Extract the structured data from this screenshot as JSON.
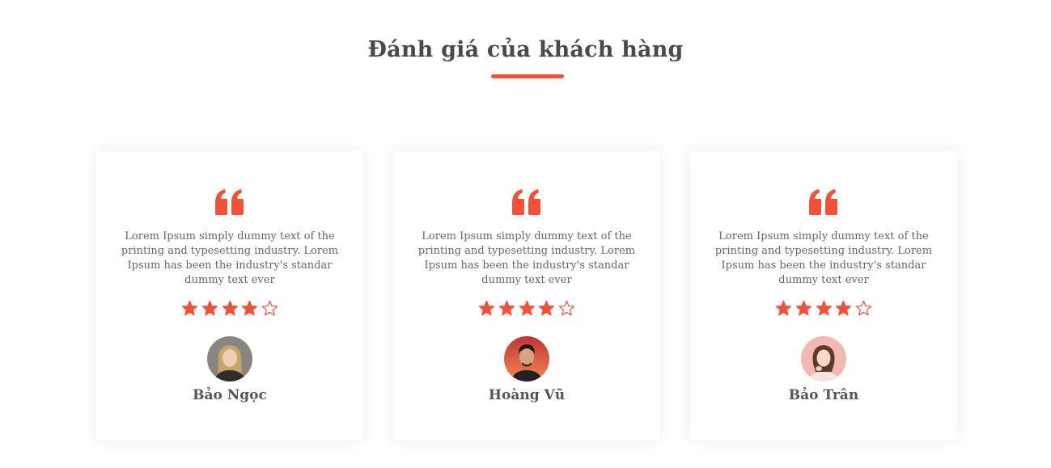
{
  "section": {
    "title": "Đánh giá của khách hàng"
  },
  "colors": {
    "accent": "#f05138",
    "text": "#555555"
  },
  "testimonials": [
    {
      "text": "Lorem Ipsum simply dummy text of the printing and typesetting industry. Lorem Ipsum has been the industry's standar dummy text ever",
      "rating": 4,
      "max_rating": 5,
      "name": "Bảo Ngọc"
    },
    {
      "text": "Lorem Ipsum simply dummy text of the printing and typesetting industry. Lorem Ipsum has been the industry's standar dummy text ever",
      "rating": 4,
      "max_rating": 5,
      "name": "Hoàng Vũ"
    },
    {
      "text": "Lorem Ipsum simply dummy text of the printing and typesetting industry. Lorem Ipsum has been the industry's standar dummy text ever",
      "rating": 4,
      "max_rating": 5,
      "name": "Bảo Trân"
    }
  ]
}
